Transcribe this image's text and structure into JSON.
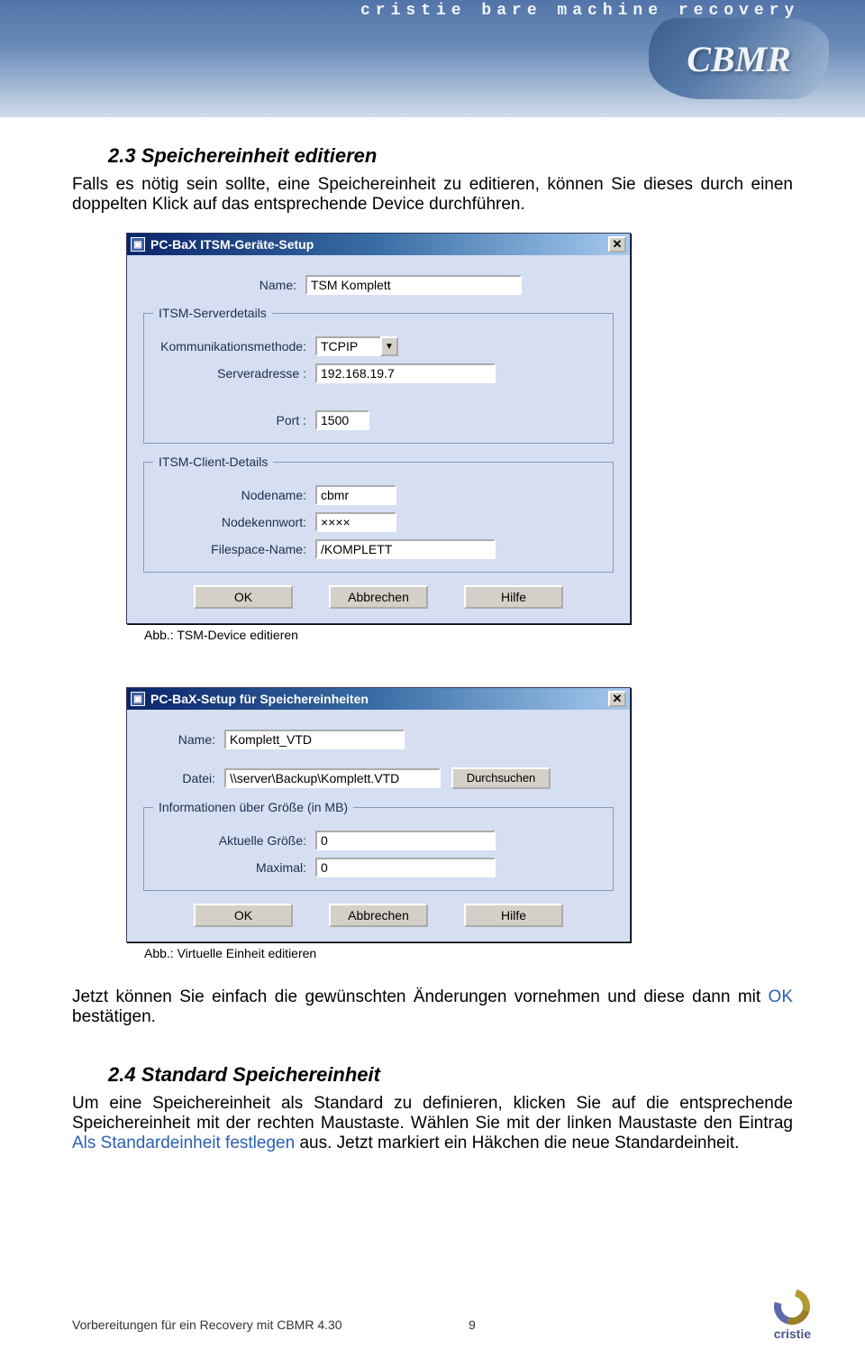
{
  "header": {
    "tagline": "cristie bare machine recovery",
    "logo": "CBMR"
  },
  "sec23": {
    "heading": "2.3  Speichereinheit editieren",
    "para": "Falls es nötig sein sollte, eine Speichereinheit zu editieren, können Sie dieses durch einen doppelten Klick auf das entsprechende Device durchführen."
  },
  "dlg1": {
    "title": "PC-BaX ITSM-Geräte-Setup",
    "name_label": "Name:",
    "name_value": "TSM Komplett",
    "fs1_legend": "ITSM-Serverdetails",
    "comm_label": "Kommunikationsmethode:",
    "comm_value": "TCPIP",
    "addr_label": "Serveradresse :",
    "addr_value": "192.168.19.7",
    "port_label": "Port :",
    "port_value": "1500",
    "fs2_legend": "ITSM-Client-Details",
    "node_label": "Nodename:",
    "node_value": "cbmr",
    "pw_label": "Nodekennwort:",
    "pw_value": "××××",
    "fsn_label": "Filespace-Name:",
    "fsn_value": "/KOMPLETT",
    "ok": "OK",
    "cancel": "Abbrechen",
    "help": "Hilfe"
  },
  "caption1": "Abb.: TSM-Device editieren",
  "dlg2": {
    "title": "PC-BaX-Setup für Speichereinheiten",
    "name_label": "Name:",
    "name_value": "Komplett_VTD",
    "file_label": "Datei:",
    "file_value": "\\\\server\\Backup\\Komplett.VTD",
    "browse": "Durchsuchen",
    "fs_legend": "Informationen über Größe (in MB)",
    "cur_label": "Aktuelle Größe:",
    "cur_value": "0",
    "max_label": "Maximal:",
    "max_value": "0",
    "ok": "OK",
    "cancel": "Abbrechen",
    "help": "Hilfe"
  },
  "caption2": "Abb.: Virtuelle Einheit editieren",
  "sec23b": {
    "line1": "Jetzt können Sie einfach die gewünschten Änderungen vornehmen und diese dann mit ",
    "ok": "OK",
    "line2": " bestätigen."
  },
  "sec24": {
    "heading": "2.4  Standard Speichereinheit",
    "p1a": "Um eine Speichereinheit als Standard zu definieren, klicken Sie auf die entsprechende Speichereinheit mit der rechten Maustaste. Wählen Sie mit der linken Maustaste den Eintrag ",
    "menu": "Als Standardeinheit festlegen",
    "p1b": " aus. Jetzt markiert ein Häkchen die neue Standardeinheit."
  },
  "footer": {
    "text": "Vorbereitungen für ein Recovery mit CBMR 4.30",
    "page": "9",
    "brand": "cristie"
  }
}
